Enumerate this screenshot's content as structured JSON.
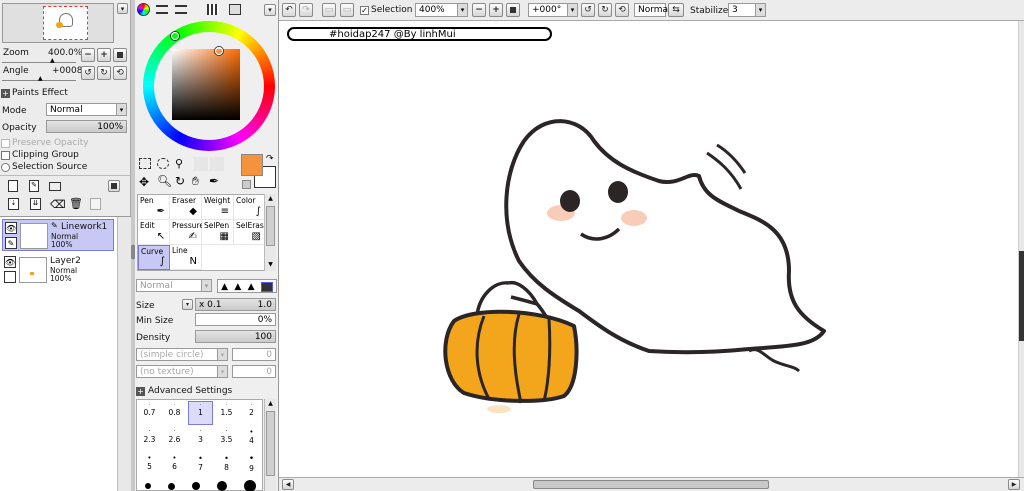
{
  "navigator": {
    "zoom_label": "Zoom",
    "zoom_value": "400.0%",
    "angle_label": "Angle",
    "angle_value": "+0008"
  },
  "paints_effect": {
    "title": "Paints Effect",
    "mode_label": "Mode",
    "mode_value": "Normal",
    "opacity_label": "Opacity",
    "opacity_value": "100%",
    "preserve_opacity": "Preserve Opacity",
    "clipping_group": "Clipping Group",
    "selection_source": "Selection Source"
  },
  "layers": [
    {
      "name": "Linework1",
      "mode": "Normal",
      "opacity": "100%",
      "selected": true
    },
    {
      "name": "Layer2",
      "mode": "Normal",
      "opacity": "100%",
      "selected": false
    }
  ],
  "tools": [
    {
      "label": "Pen",
      "icon": "pen-icon"
    },
    {
      "label": "Eraser",
      "icon": "eraser-icon"
    },
    {
      "label": "Weight",
      "icon": "weight-icon"
    },
    {
      "label": "Color",
      "icon": "color-icon"
    },
    {
      "label": "Edit",
      "icon": "edit-icon"
    },
    {
      "label": "Pressure",
      "icon": "pressure-icon"
    },
    {
      "label": "SelPen",
      "icon": "selpen-icon"
    },
    {
      "label": "SelEras",
      "icon": "seleras-icon"
    },
    {
      "label": "Curve",
      "icon": "curve-icon"
    },
    {
      "label": "Line",
      "icon": "line-icon"
    }
  ],
  "brush": {
    "blend_mode": "Normal",
    "size_label": "Size",
    "size_multiplier": "x 0.1",
    "size_value": "1.0",
    "min_size_label": "Min Size",
    "min_size_value": "0%",
    "density_label": "Density",
    "density_value": "100",
    "shape_select": "(simple circle)",
    "shape_value": "0",
    "texture_select": "(no texture)",
    "texture_value": "0",
    "advanced_settings": "Advanced Settings",
    "sizes_row1": [
      "0.7",
      "0.8",
      "1",
      "1.5",
      "2"
    ],
    "sizes_row2": [
      "2.3",
      "2.6",
      "3",
      "3.5",
      "4"
    ],
    "sizes_row3": [
      "5",
      "6",
      "7",
      "8",
      "9"
    ]
  },
  "toolbar": {
    "selection_label": "Selection",
    "zoom_value": "400%",
    "angle_value": "+000°",
    "blend_value": "Normal",
    "stabilizer_label": "Stabilizer",
    "stabilizer_value": "3"
  },
  "canvas": {
    "watermark": "#hoidap247 @By linhMui"
  },
  "colors": {
    "primary": "#f5923e",
    "secondary": "#ffffff",
    "pumpkin": "#f3a51c",
    "accent_select": "#c8c8f4"
  }
}
